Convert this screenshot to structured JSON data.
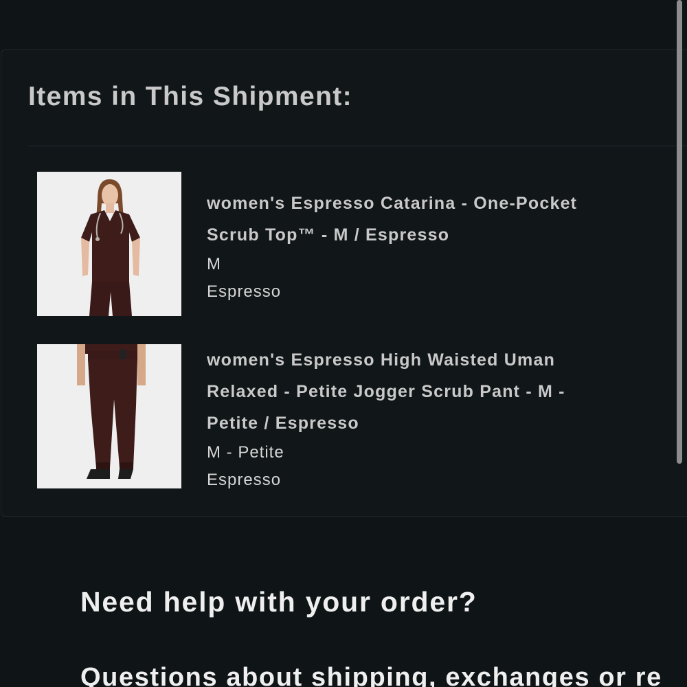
{
  "shipment": {
    "title": "Items in This Shipment:",
    "items": [
      {
        "name": "women's Espresso Catarina - One-Pocket Scrub Top™ - M / Espresso",
        "size": "M",
        "color": "Espresso",
        "image": "scrub-top-photo"
      },
      {
        "name": "women's Espresso High Waisted Uman Relaxed - Petite Jogger Scrub Pant - M - Petite / Espresso",
        "size": "M - Petite",
        "color": "Espresso",
        "image": "jogger-pant-photo"
      }
    ]
  },
  "help": {
    "title": "Need help with your order?",
    "text": "Questions about shipping, exchanges or re"
  },
  "colors": {
    "background": "#0f1417",
    "card": "#111619",
    "title_text": "#c9c9c9",
    "body_text": "#efefef",
    "product_espresso": "#3d1c1a"
  }
}
